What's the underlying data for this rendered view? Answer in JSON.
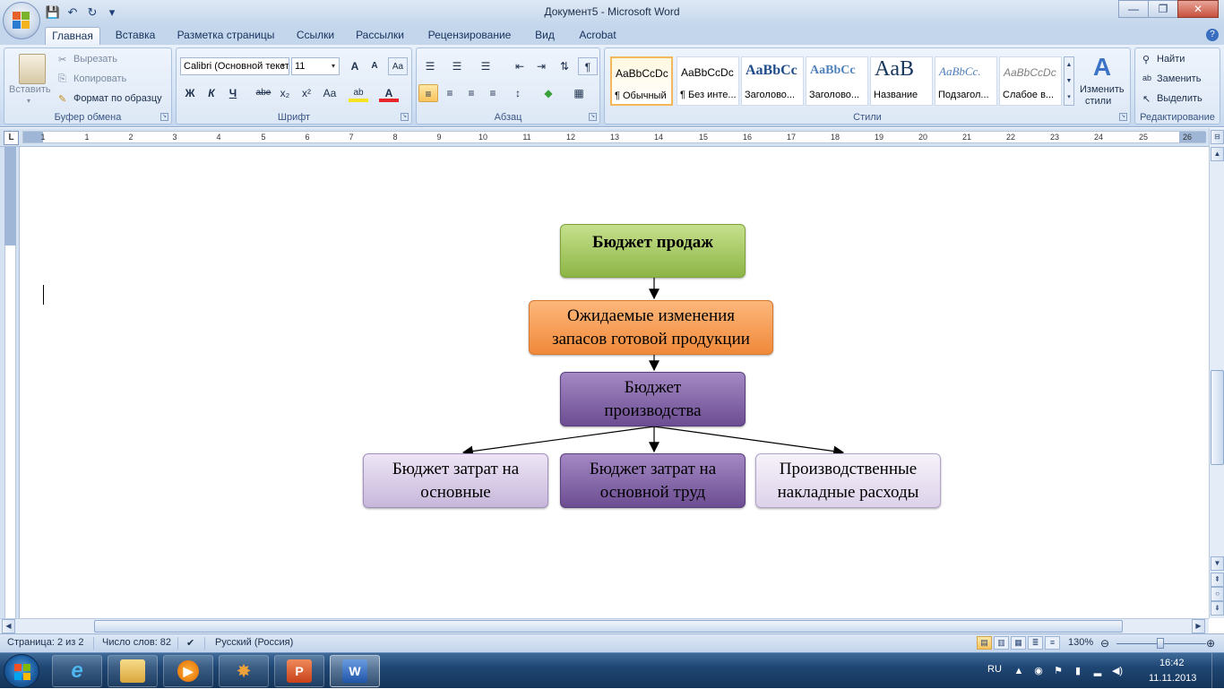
{
  "window": {
    "title": "Документ5 - Microsoft Word",
    "minimize": "—",
    "maximize": "❐",
    "close": "✕"
  },
  "quick_access": {
    "save": "💾",
    "undo": "↶",
    "redo": "↻",
    "customize": "▾"
  },
  "tabs": [
    "Главная",
    "Вставка",
    "Разметка страницы",
    "Ссылки",
    "Рассылки",
    "Рецензирование",
    "Вид",
    "Acrobat"
  ],
  "active_tab": "Главная",
  "ribbon": {
    "clipboard": {
      "label": "Буфер обмена",
      "paste": "Вставить",
      "cut": "Вырезать",
      "copy": "Копировать",
      "format_painter": "Формат по образцу"
    },
    "font": {
      "label": "Шрифт",
      "font_name": "Calibri (Основной текст)",
      "font_size": "11",
      "grow": "A",
      "shrink": "A",
      "clear": "Aa",
      "bold": "Ж",
      "italic": "К",
      "underline": "Ч",
      "strike": "abe",
      "subscript": "x₂",
      "superscript": "x²",
      "case": "Aa",
      "highlight": "ab",
      "color": "A"
    },
    "paragraph": {
      "label": "Абзац"
    },
    "styles": {
      "label": "Стили",
      "tiles": [
        {
          "sample": "AaBbCcDc",
          "name": "¶ Обычный"
        },
        {
          "sample": "AaBbCcDc",
          "name": "¶ Без инте..."
        },
        {
          "sample": "AaBbCc",
          "name": "Заголово..."
        },
        {
          "sample": "AaBbCc",
          "name": "Заголово..."
        },
        {
          "sample": "AaB",
          "name": "Название"
        },
        {
          "sample": "AaBbCc.",
          "name": "Подзагол..."
        },
        {
          "sample": "AaBbCcDc",
          "name": "Слабое в..."
        }
      ],
      "change_styles_line1": "Изменить",
      "change_styles_line2": "стили"
    },
    "editing": {
      "label": "Редактирование",
      "find": "Найти",
      "replace": "Заменить",
      "select": "Выделить"
    }
  },
  "ruler": {
    "corner": "L",
    "numbers": [
      "2",
      "1",
      "1",
      "2",
      "3",
      "4",
      "5",
      "6",
      "7",
      "8",
      "9",
      "10",
      "11",
      "12",
      "13",
      "14",
      "15",
      "16",
      "17",
      "18",
      "19",
      "20",
      "21",
      "22",
      "23",
      "24",
      "25",
      "26"
    ]
  },
  "diagram": {
    "sales_budget": "Бюджет продаж",
    "inventory_line1": "Ожидаемые изменения",
    "inventory_line2": "запасов готовой продукции",
    "production_line1": "Бюджет",
    "production_line2": "производства",
    "materials_line1": "Бюджет затрат на",
    "materials_line2": "основные",
    "labor_line1": "Бюджет затрат на",
    "labor_line2": "основной труд",
    "overhead_line1": "Производственные",
    "overhead_line2": "накладные расходы"
  },
  "status": {
    "page": "Страница: 2 из 2",
    "words": "Число слов: 82",
    "language": "Русский (Россия)",
    "zoom": "130%"
  },
  "taskbar": {
    "lang": "RU",
    "time": "16:42",
    "date": "11.11.2013"
  },
  "colors": {
    "green": "#9bc25a",
    "orange": "#f59a4a",
    "purple": "#7d5fa0",
    "lavender": "#d8cce6"
  }
}
